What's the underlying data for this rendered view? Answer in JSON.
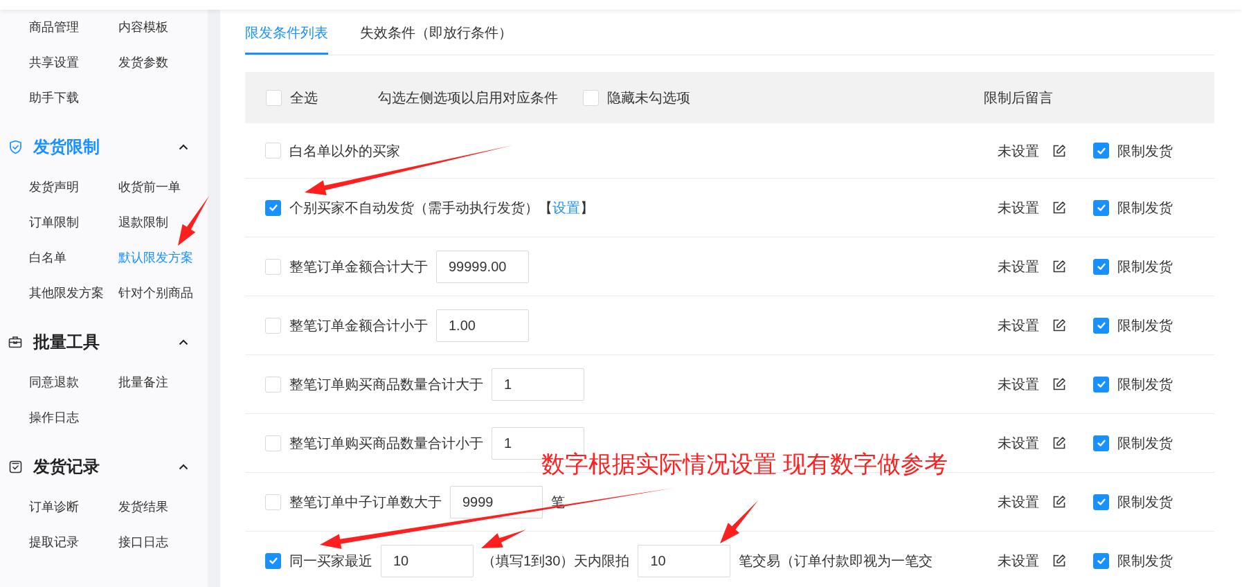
{
  "sidebar": {
    "top_items": [
      {
        "label": "商品管理",
        "selected": false
      },
      {
        "label": "内容模板",
        "selected": false
      },
      {
        "label": "共享设置",
        "selected": false
      },
      {
        "label": "发货参数",
        "selected": false
      },
      {
        "label": "助手下载",
        "selected": false
      }
    ],
    "sections": [
      {
        "title": "发货限制",
        "selected": true,
        "expanded": true,
        "items": [
          {
            "label": "发货声明",
            "selected": false
          },
          {
            "label": "收货前一单",
            "selected": false
          },
          {
            "label": "订单限制",
            "selected": false
          },
          {
            "label": "退款限制",
            "selected": false
          },
          {
            "label": "白名单",
            "selected": false
          },
          {
            "label": "默认限发方案",
            "selected": true
          },
          {
            "label": "其他限发方案",
            "selected": false
          },
          {
            "label": "针对个别商品",
            "selected": false
          }
        ]
      },
      {
        "title": "批量工具",
        "selected": false,
        "expanded": true,
        "items": [
          {
            "label": "同意退款",
            "selected": false
          },
          {
            "label": "批量备注",
            "selected": false
          },
          {
            "label": "操作日志",
            "selected": false
          }
        ]
      },
      {
        "title": "发货记录",
        "selected": false,
        "expanded": true,
        "items": [
          {
            "label": "订单诊断",
            "selected": false
          },
          {
            "label": "发货结果",
            "selected": false
          },
          {
            "label": "提取记录",
            "selected": false
          },
          {
            "label": "接口日志",
            "selected": false
          }
        ]
      }
    ]
  },
  "tabs": [
    {
      "label": "限发条件列表",
      "selected": true
    },
    {
      "label": "失效条件（即放行条件）",
      "selected": false
    }
  ],
  "header": {
    "select_all": {
      "label": "全选",
      "checked": false
    },
    "hint": "勾选左侧选项以启用对应条件",
    "hide_unchecked": {
      "label": "隐藏未勾选项",
      "checked": false
    },
    "message_column": "限制后留言"
  },
  "rows": [
    {
      "checked": false,
      "parts": [
        {
          "kind": "text",
          "text": "白名单以外的买家"
        }
      ],
      "message": "未设置",
      "restrict": {
        "label": "限制发货",
        "checked": true
      }
    },
    {
      "checked": true,
      "parts": [
        {
          "kind": "text",
          "text": "个别买家不自动发货（需手动执行发货）【"
        },
        {
          "kind": "link",
          "text": "设置"
        },
        {
          "kind": "text",
          "text": "】"
        }
      ],
      "message": "未设置",
      "restrict": {
        "label": "限制发货",
        "checked": true
      }
    },
    {
      "checked": false,
      "parts": [
        {
          "kind": "text",
          "text": "整笔订单金额合计大于"
        },
        {
          "kind": "input",
          "value": "99999.00"
        }
      ],
      "message": "未设置",
      "restrict": {
        "label": "限制发货",
        "checked": true
      }
    },
    {
      "checked": false,
      "parts": [
        {
          "kind": "text",
          "text": "整笔订单金额合计小于"
        },
        {
          "kind": "input",
          "value": "1.00"
        }
      ],
      "message": "未设置",
      "restrict": {
        "label": "限制发货",
        "checked": true
      }
    },
    {
      "checked": false,
      "parts": [
        {
          "kind": "text",
          "text": "整笔订单购买商品数量合计大于"
        },
        {
          "kind": "input",
          "value": "1"
        }
      ],
      "message": "未设置",
      "restrict": {
        "label": "限制发货",
        "checked": true
      }
    },
    {
      "checked": false,
      "parts": [
        {
          "kind": "text",
          "text": "整笔订单购买商品数量合计小于"
        },
        {
          "kind": "input",
          "value": "1"
        }
      ],
      "message": "未设置",
      "restrict": {
        "label": "限制发货",
        "checked": true
      }
    },
    {
      "checked": false,
      "parts": [
        {
          "kind": "text",
          "text": "整笔订单中子订单数大于"
        },
        {
          "kind": "input",
          "value": "9999"
        },
        {
          "kind": "text",
          "text": "笔"
        }
      ],
      "message": "未设置",
      "restrict": {
        "label": "限制发货",
        "checked": true
      }
    },
    {
      "checked": true,
      "parts": [
        {
          "kind": "text",
          "text": "同一买家最近"
        },
        {
          "kind": "input",
          "value": "10"
        },
        {
          "kind": "text",
          "text": "（填写1到30）天内限拍"
        },
        {
          "kind": "input",
          "value": "10"
        },
        {
          "kind": "text",
          "text": "笔交易（订单付款即视为一笔交"
        }
      ],
      "message": "未设置",
      "restrict": {
        "label": "限制发货",
        "checked": true
      }
    }
  ],
  "annotation": {
    "text": "数字根据实际情况设置 现有数字做参考"
  }
}
